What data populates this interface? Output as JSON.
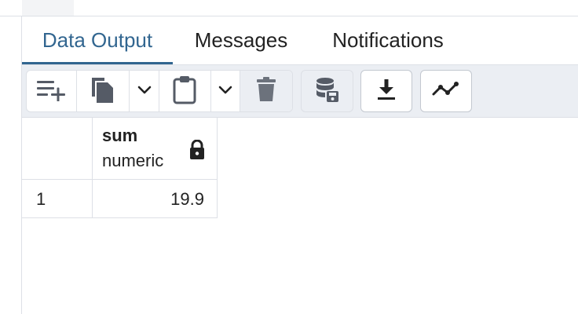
{
  "tabs": [
    {
      "label": "Data Output",
      "active": true
    },
    {
      "label": "Messages",
      "active": false
    },
    {
      "label": "Notifications",
      "active": false
    }
  ],
  "toolbar": {
    "add_row_icon": "add-row-icon",
    "copy_icon": "copy-icon",
    "copy_dropdown_icon": "chevron-down-icon",
    "paste_icon": "paste-icon",
    "paste_dropdown_icon": "chevron-down-icon",
    "delete_icon": "trash-icon",
    "save_data_icon": "save-data-icon",
    "download_icon": "download-icon",
    "graph_icon": "graph-visualiser-icon"
  },
  "grid": {
    "columns": [
      {
        "name": "sum",
        "type": "numeric",
        "locked": true
      }
    ],
    "rows": [
      {
        "row_number": "1",
        "values": [
          "19.9"
        ]
      }
    ]
  },
  "colors": {
    "accent": "#326690",
    "toolbar_bg": "#ebeef3",
    "border": "#dde0e6",
    "icon": "#555b66"
  }
}
